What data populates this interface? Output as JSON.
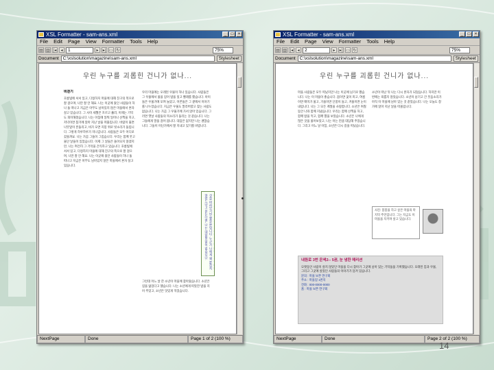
{
  "app": {
    "title": "XSL Formatter - sam-ans.xml",
    "menu": [
      "File",
      "Edit",
      "Page",
      "View",
      "Formatter",
      "Tools",
      "Help"
    ],
    "zoom": "75%",
    "address_label": "Document",
    "address": "C:\\xslsolution\\magazine\\sam-ans.xml",
    "stylesheet_button": "Stylesheet",
    "window_buttons": [
      "_",
      "□",
      "×"
    ]
  },
  "pages": [
    {
      "page_input": "1",
      "heading": "우린 누구를 괴롭힌 건니가 없나...",
      "col1_title": "비걷기",
      "col1": "호롱빛에 서서 있고, 다정하지 마을에 대해 친구의 쪽으로 잘 걸으며, 나만 잘 안 해요. 나는 이곳에 왔던 사람들이 하나 둘 떠나고 지금은 아무도 남아있지 않은 마을에서 혼자 살고 있습니다. 그 사이 세월은 흐르고 흘러, 이제는 기억도 희미해졌습니다. 나는 아침에 일찍 일어나 산책을 하고, 저녁이면 창가에 앉아 지난 날을 떠올립니다. 바람이 불면 나뭇잎이 흔들리고, 비가 오면 지붕 위로 빗소리가 들립니다. 그렇게 하루하루가 지나갑니다. 사람들은 모두 어디로 갔을까요. 나는 가끔 그들이 그립습니다. 우리는 함께 웃고 울던 날들이 있었습니다. 이제 그 날들은 돌아오지 않겠지만, 나는 여전히 그 기억을 간직하고 있습니다. 호롱빛에 서서 있고, 다정하지 마을에 대해 친구의 쪽으로 잘 걸으며, 나만 잘 안 해요. 나는 이곳에 왔던 사람들이 하나 둘 떠나고 지금은 아무도 남아있지 않은 마을에서 혼자 살고 있습니다.",
      "col2": "우리 마을에는 오래된 우물이 하나 있습니다. 사람들은 그 우물에서 물을 길어 밥을 짓고 빨래를 했습니다. 아이들은 우물가에 모여 놀았고, 어른들은 그 곁에서 이야기를 나누었습니다. 지금은 우물도 말라버렸고 찾는 사람도 없습니다. 나는 가끔 그 우물가에 가서 앉아 있습니다. 그러면 옛날 사람들의 목소리가 들리는 것 같습니다. 나는 그들에게 말을 걸어 봅니다. 대답은 없지만 나는 괜찮습니다. 그들이 어딘가에서 잘 지내고 있기를 바랍니다.",
      "sidebox": "나는 그 사람들을 괴롭히지 않았습니다. 다만 그들이 떠나는 것을 바라보기만 했을 뿐입니다. 누군가 나에게 왜 붙잡지 않았느냐고 묻는다면, 나는 대답할 말이 없습니다.",
      "col2b": "그런데 어느 날 한 소년이 마을에 찾아왔습니다. 소년은 길을 잃었다고 했습니다. 나는 소년에게 따뜻한 밥을 지어 주었고, 소년은 맛있게 먹었습니다.",
      "status": [
        "NextPage",
        "Done",
        "Page 1 of 2 (100 %)"
      ]
    },
    {
      "page_input": "2",
      "heading": "우린 누구를 괴롭힌 건니가 없나...",
      "col1": "마을 사람들은 모두 떠났지만 나는 이곳에 남기로 했습니다. 나는 이 마을이 좋습니다. 봄이면 꽃이 피고, 여름이면 매미가 울고, 가을이면 단풍이 들고, 겨울이면 눈이 내립니다. 나는 그 모든 계절을 사랑합니다. 소년은 며칠 동안 나와 함께 지냈습니다. 우리는 함께 산책을 하고, 함께 밥을 먹고, 함께 별을 보았습니다. 소년은 나에게 많은 것을 물어보았고, 나는 아는 만큼 대답해 주었습니다. 그리고 어느 날 아침, 소년은 다시 길을 떠났습니다.",
      "col2": "소년이 떠난 뒤 나는 다시 혼자가 되었습니다. 하지만 이번에는 외롭지 않았습니다. 소년이 남기고 간 웃음소리가 아직 이 마을에 남아 있는 것 같았습니다. 나는 오늘도 창가에 앉아 지난 날을 떠올립니다.",
      "caption": "사진: 봉봉을 하고 싶은 마을의 마지막 주민입니다. 그는 지금도 이 마을을 지키며 살고 있습니다.",
      "box_title": "내원로 3번 은색2-- 5권, 눈 냉한 메리션",
      "box_body": "오랫동안 사람이 살지 않았던 마을을 다시 찾아가 그곳에 남아 있는 기억들을 기록했습니다. 오래된 집과 우물, 그리고 그곳에 살았던 사람들의 이야기가 담겨 있습니다.",
      "box_list": [
        "문의 : 마을 보존 연구회",
        "주소 : 마을길 1번지",
        "전화 : 000-0000-0000",
        "홈 : 마을 보존 연구회"
      ],
      "status": [
        "NextPage",
        "Done",
        "Page 2 of 2 (100 %)"
      ]
    }
  ],
  "page_number": "14"
}
